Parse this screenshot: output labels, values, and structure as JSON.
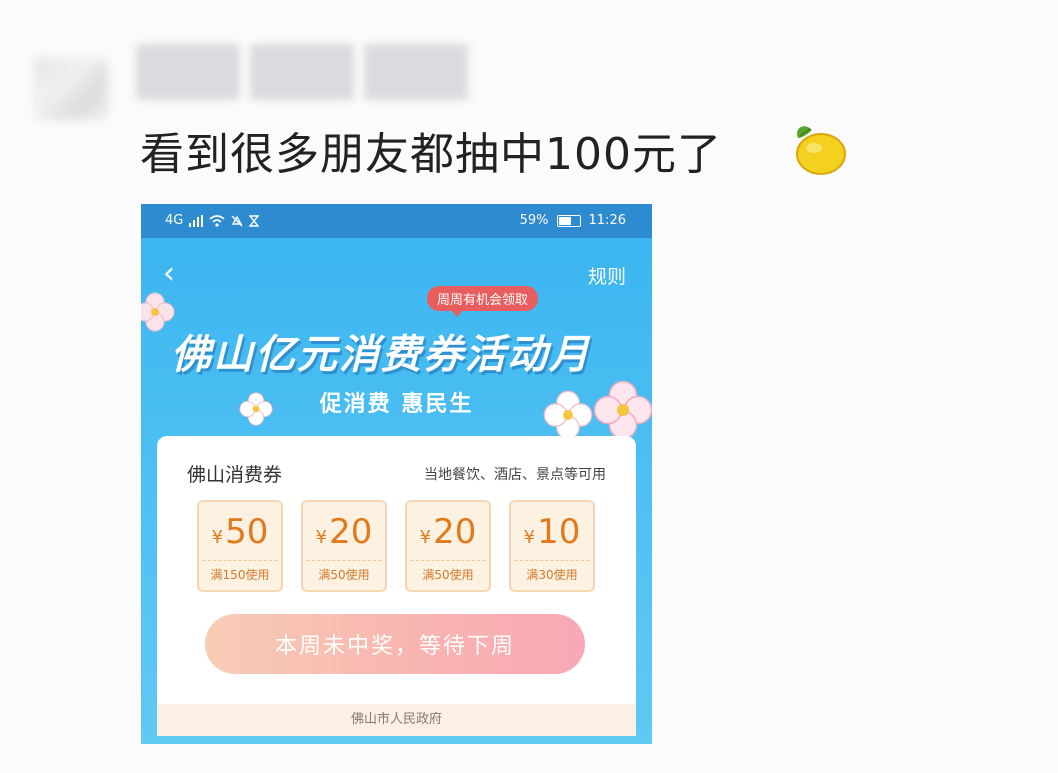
{
  "post": {
    "text": "看到很多朋友都抽中100元了",
    "emoji": "lemon-icon"
  },
  "statusbar": {
    "battery": "59%",
    "time": "11:26",
    "network": "4G"
  },
  "header": {
    "back_icon": "back-arrow-icon",
    "rules_label": "规则"
  },
  "banner": {
    "badge": "周周有机会领取",
    "title": "佛山亿元消费券活动月",
    "subtitle": "促消费 惠民生"
  },
  "card": {
    "title": "佛山消费券",
    "note": "当地餐饮、酒店、景点等可用",
    "coupons": [
      {
        "currency": "¥",
        "amount": "50",
        "condition": "满150使用"
      },
      {
        "currency": "¥",
        "amount": "20",
        "condition": "满50使用"
      },
      {
        "currency": "¥",
        "amount": "20",
        "condition": "满50使用"
      },
      {
        "currency": "¥",
        "amount": "10",
        "condition": "满30使用"
      }
    ],
    "button_label": "本周未中奖，等待下周",
    "footer": "佛山市人民政府"
  },
  "colors": {
    "banner_blue": "#38b3ef",
    "coupon_orange": "#e07a1c",
    "badge_red": "#e85d5d"
  }
}
